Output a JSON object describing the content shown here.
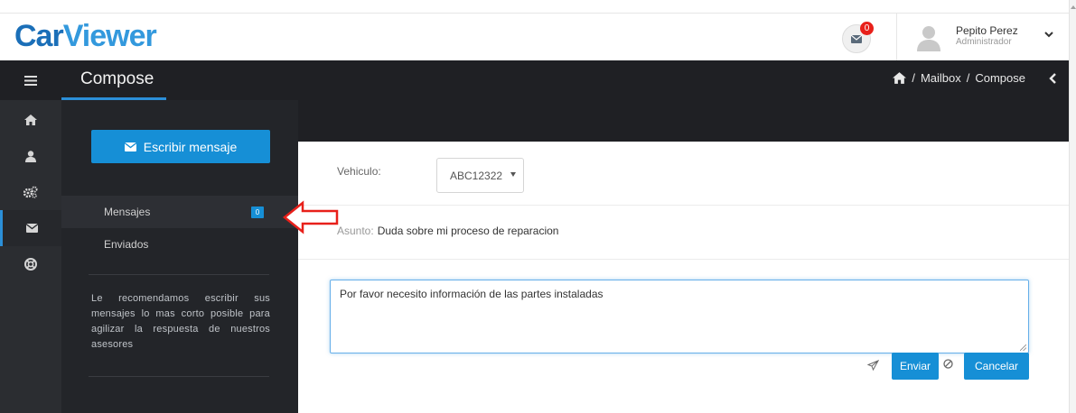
{
  "app": {
    "logo_part1": "Car",
    "logo_part2": "Viewer"
  },
  "header": {
    "notification_count": "0",
    "user_name": "Pepito Perez",
    "user_role": "Administrador"
  },
  "titlebar": {
    "title": "Compose",
    "breadcrumb": [
      "Mailbox",
      "Compose"
    ],
    "separator": "/"
  },
  "sidebar": {
    "icons": [
      "home-icon",
      "user-icon",
      "cogs-icon",
      "envelope-icon",
      "life-ring-icon"
    ],
    "active": "envelope-icon"
  },
  "mailbox": {
    "compose_label": "Escribir mensaje",
    "folders": [
      {
        "label": "Mensajes",
        "badge": "0",
        "active": true
      },
      {
        "label": "Enviados"
      }
    ],
    "tip": "Le recomendamos escribir sus mensajes lo mas corto posible para agilizar la respuesta de nuestros asesores"
  },
  "form": {
    "vehicle_label": "Vehiculo:",
    "vehicle_value": "ABC12322",
    "subject_label": "Asunto:",
    "subject_value": "Duda sobre mi proceso de reparacion",
    "message": "Por favor necesito información de las partes instaladas",
    "send_label": "Enviar",
    "cancel_label": "Cancelar"
  },
  "colors": {
    "accent": "#168fd6",
    "dark_bg": "#232529",
    "annotation": "#e8201a"
  }
}
